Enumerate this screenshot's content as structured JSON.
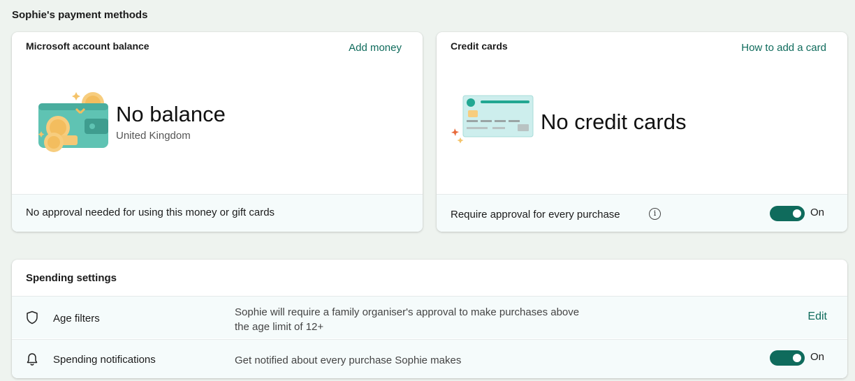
{
  "page": {
    "title": "Sophie's payment methods"
  },
  "balance_card": {
    "title": "Microsoft account balance",
    "link": "Add money",
    "amount": "No balance",
    "region": "United Kingdom",
    "footer": "No approval needed for using this money or gift cards",
    "illustration_icon": "wallet-coins-icon"
  },
  "credit_card": {
    "title": "Credit cards",
    "link": "How to add a card",
    "status": "No credit cards",
    "footer": "Require approval for every purchase",
    "info_icon": "info-icon",
    "info_glyph": "i",
    "toggle_label": "On",
    "toggle_state": true,
    "illustration_icon": "credit-card-icon"
  },
  "spending": {
    "title": "Spending settings",
    "rows": [
      {
        "icon": "shield-icon",
        "label": "Age filters",
        "description_line1": "Sophie will require a family organiser's approval to make purchases above",
        "description_line2": "the age limit of 12+",
        "action": "Edit"
      },
      {
        "icon": "bell-icon",
        "label": "Spending notifications",
        "description_line1": "Get notified about every purchase Sophie makes",
        "toggle_label": "On",
        "toggle_state": true
      }
    ]
  },
  "colors": {
    "accent": "#0f6b5c",
    "background": "#eef3ef",
    "footer_bg": "#f5fbfb"
  }
}
